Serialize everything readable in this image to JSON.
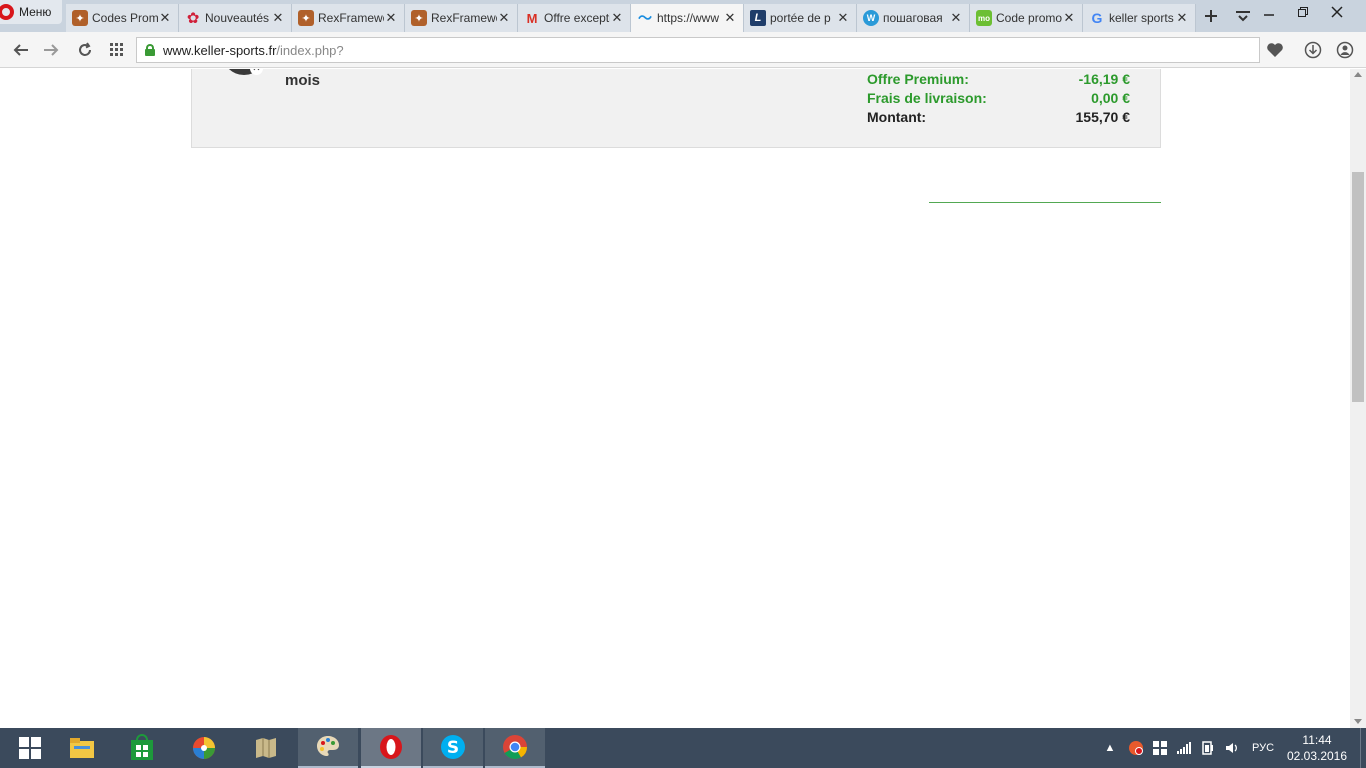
{
  "browser": {
    "menu_label": "Меню",
    "tabs": [
      {
        "title": "Codes Promo",
        "icon": "squirrel-favicon",
        "active": false
      },
      {
        "title": "Nouveautés",
        "icon": "flower-favicon",
        "active": false
      },
      {
        "title": "RexFramework",
        "icon": "squirrel-favicon",
        "active": false
      },
      {
        "title": "RexFramework",
        "icon": "squirrel-favicon",
        "active": false
      },
      {
        "title": "Offre exceptionnelle",
        "icon": "gmail-favicon",
        "active": false
      },
      {
        "title": "https://www",
        "icon": "wave-favicon",
        "active": true
      },
      {
        "title": "portée de p",
        "icon": "l-favicon",
        "active": false
      },
      {
        "title": "пошаговая",
        "icon": "w-favicon",
        "active": false
      },
      {
        "title": "Code promo",
        "icon": "mo-favicon",
        "active": false
      },
      {
        "title": "keller sports",
        "icon": "google-favicon",
        "active": false
      }
    ],
    "url": {
      "domain": "www.keller-sports.fr",
      "path": "/index.php?"
    }
  },
  "page": {
    "product_text": "mois",
    "totals": [
      {
        "label": "Offre Premium:",
        "value": "-16,19 €",
        "style": "green"
      },
      {
        "label": "Frais de livraison:",
        "value": "0,00 €",
        "style": "green"
      },
      {
        "label": "Montant:",
        "value": "155,70 €",
        "style": "dark"
      }
    ],
    "accent_color": "#16a9e0",
    "green_color": "#2c9a2c"
  },
  "taskbar": {
    "language": "РУС",
    "time": "11:44",
    "date": "02.03.2016"
  }
}
